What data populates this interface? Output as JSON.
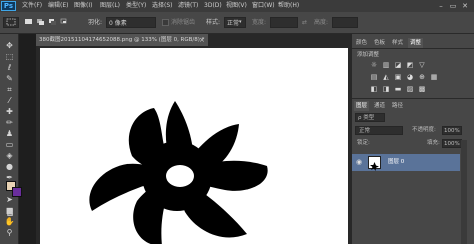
{
  "app": {
    "logo": "Ps"
  },
  "menu": [
    "文件(F)",
    "编辑(E)",
    "图像(I)",
    "图层(L)",
    "类型(Y)",
    "选择(S)",
    "滤镜(T)",
    "3D(D)",
    "视图(V)",
    "窗口(W)",
    "帮助(H)"
  ],
  "window_buttons": [
    "–",
    "▭",
    "✕"
  ],
  "options": {
    "feather_label": "羽化:",
    "feather_value": "0 像素",
    "antialias_label": "消除锯齿",
    "style_label": "样式:",
    "style_value": "正常",
    "width_label": "宽度:",
    "height_label": "高度:"
  },
  "document": {
    "tab_title": "380截图20151104174652088.png @ 133% (图层 0, RGB/8) *",
    "close": "×"
  },
  "panels": {
    "top_tabs": [
      "颜色",
      "色板",
      "样式",
      "调整"
    ],
    "adjust_title": "添加调整",
    "adj_icons_row1": [
      "☼",
      "▥",
      "◪",
      "◩",
      "▽"
    ],
    "adj_icons_row2": [
      "▤",
      "◭",
      "▣",
      "◕",
      "⊕",
      "▦"
    ],
    "adj_icons_row3": [
      "◧",
      "◨",
      "▬",
      "▨",
      "▩"
    ]
  },
  "layers": {
    "tabs": [
      "图层",
      "通道",
      "路径"
    ],
    "kind_label": "ρ 类型",
    "blend_mode": "正常",
    "opacity_label": "不透明度:",
    "opacity_value": "100%",
    "lock_label": "锁定:",
    "fill_label": "填充:",
    "fill_value": "100%",
    "layer_name": "图层 0"
  },
  "colors": {
    "foreground": "#e9d3b4",
    "background": "#6a2e9c",
    "selected_layer": "#5a7399"
  }
}
